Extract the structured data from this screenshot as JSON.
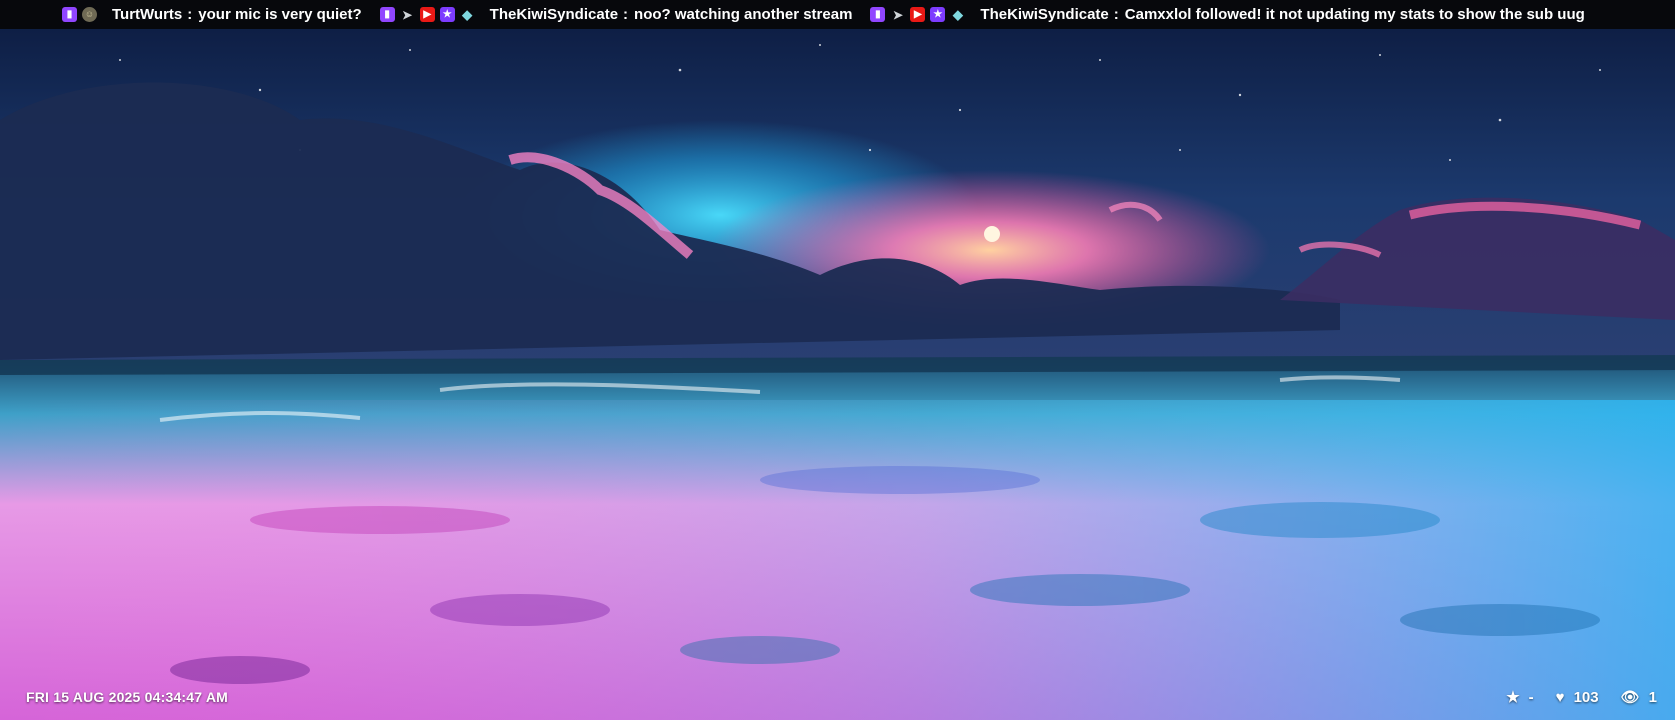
{
  "chat": {
    "messages": [
      {
        "badges": [
          "twitch-badge-icon",
          "profile-face-badge-icon"
        ],
        "user": "TurtWurts",
        "sep": ":",
        "text": "your mic is very quiet?"
      },
      {
        "badges": [
          "twitch-badge-icon",
          "cursor-badge-icon",
          "video-badge-icon",
          "star-badge-icon",
          "diamond-badge-icon"
        ],
        "user": "TheKiwiSyndicate",
        "sep": ":",
        "text": "noo?  watching another stream"
      },
      {
        "badges": [
          "twitch-badge-icon",
          "cursor-badge-icon",
          "video-badge-icon",
          "star-badge-icon",
          "diamond-badge-icon"
        ],
        "user": "TheKiwiSyndicate",
        "sep": ":",
        "text": "Camxxlol followed!  it not updating my stats to show the sub uug"
      }
    ]
  },
  "footer": {
    "datetime": "FRI 15 AUG 2025 04:34:47 AM",
    "stats": {
      "star_value": "-",
      "likes": "103",
      "viewers": "1"
    }
  },
  "colors": {
    "sky_top": "#0c1a3e",
    "sky_glow": "#1ec8ff",
    "sunset_pink": "#ff6fae",
    "sea_pink": "#f4a6ee",
    "sea_blue": "#2fb6f2"
  }
}
